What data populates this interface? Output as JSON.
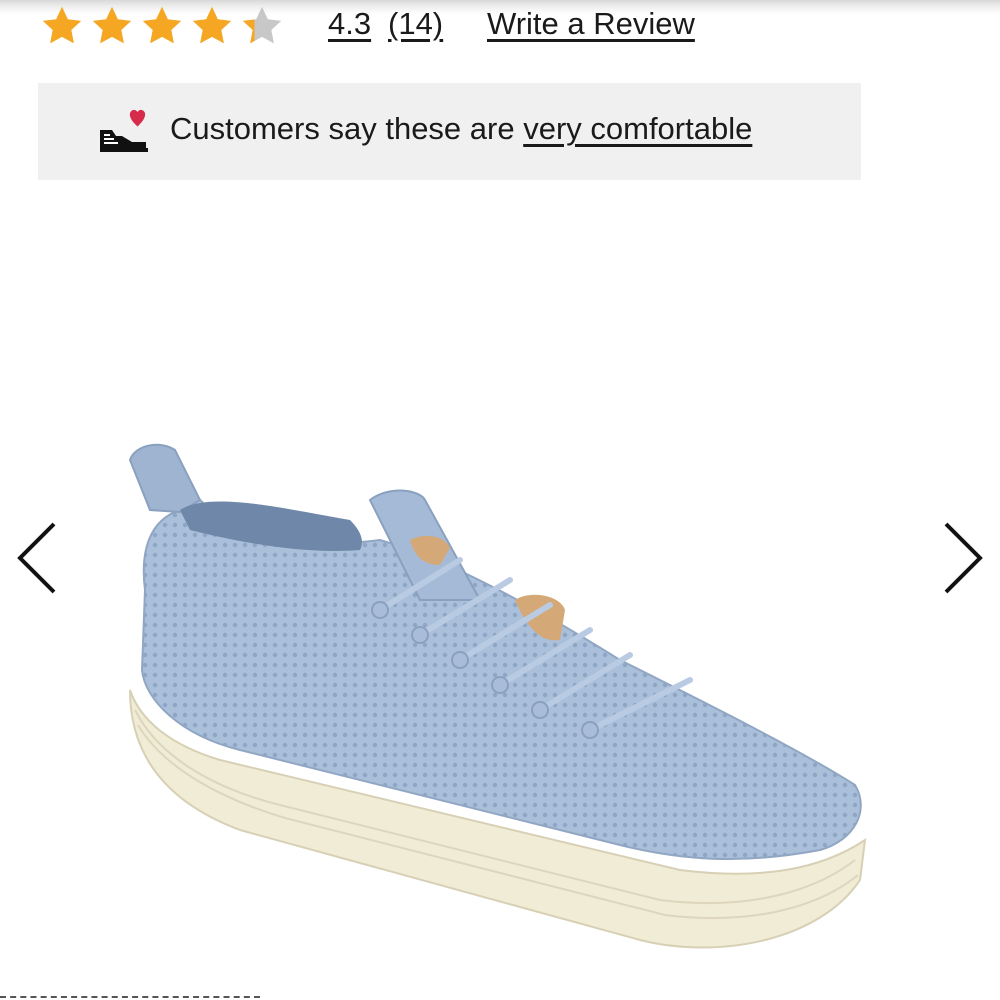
{
  "rating": {
    "stars_filled": 4.3,
    "stars_total": 5,
    "value": "4.3",
    "count": "(14)",
    "write_review": "Write a Review",
    "star_color": "#f5a623",
    "star_empty_color": "#c8c8c8"
  },
  "comfort_banner": {
    "text": "Customers say these are ",
    "link": "very comfortable",
    "icon": "sneaker-heart-icon",
    "heart_color": "#d62b4b"
  },
  "carousel": {
    "prev_icon": "chevron-left-icon",
    "next_icon": "chevron-right-icon",
    "image_alt": "Light blue knit lace-up sneaker with white platform sole"
  }
}
